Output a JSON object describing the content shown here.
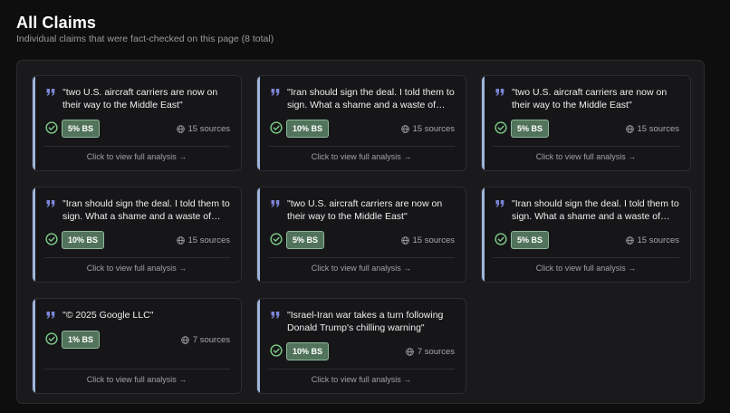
{
  "header": {
    "title": "All Claims",
    "subtitle": "Individual claims that were fact-checked on this page (8 total)"
  },
  "colors": {
    "accent_bar": "#9fb4da",
    "quote_icon": "#7d86d8",
    "check_icon": "#7ecb8a",
    "badge_bg": "#52735b"
  },
  "claims": [
    {
      "text": "\"two U.S. aircraft carriers are now on their way to the Middle East\"",
      "badge": "5% BS",
      "bs_percent": 5,
      "sources": "15 sources",
      "cta": "Click to view full analysis →"
    },
    {
      "text": "\"Iran should sign the deal. I told them to sign. What a shame and a waste of huma...",
      "badge": "10% BS",
      "bs_percent": 10,
      "sources": "15 sources",
      "cta": "Click to view full analysis →"
    },
    {
      "text": "\"two U.S. aircraft carriers are now on their way to the Middle East\"",
      "badge": "5% BS",
      "bs_percent": 5,
      "sources": "15 sources",
      "cta": "Click to view full analysis →"
    },
    {
      "text": "\"Iran should sign the deal. I told them to sign. What a shame and a waste of huma...",
      "badge": "10% BS",
      "bs_percent": 10,
      "sources": "15 sources",
      "cta": "Click to view full analysis →"
    },
    {
      "text": "\"two U.S. aircraft carriers are now on their way to the Middle East\"",
      "badge": "5% BS",
      "bs_percent": 5,
      "sources": "15 sources",
      "cta": "Click to view full analysis →"
    },
    {
      "text": "\"Iran should sign the deal. I told them to sign. What a shame and a waste of huma...",
      "badge": "5% BS",
      "bs_percent": 5,
      "sources": "15 sources",
      "cta": "Click to view full analysis →"
    },
    {
      "text": "\"© 2025 Google LLC\"",
      "badge": "1% BS",
      "bs_percent": 1,
      "sources": "7 sources",
      "cta": "Click to view full analysis →"
    },
    {
      "text": "\"Israel-Iran war takes a turn following Donald Trump's chilling warning\"",
      "badge": "10% BS",
      "bs_percent": 10,
      "sources": "7 sources",
      "cta": "Click to view full analysis →"
    }
  ]
}
